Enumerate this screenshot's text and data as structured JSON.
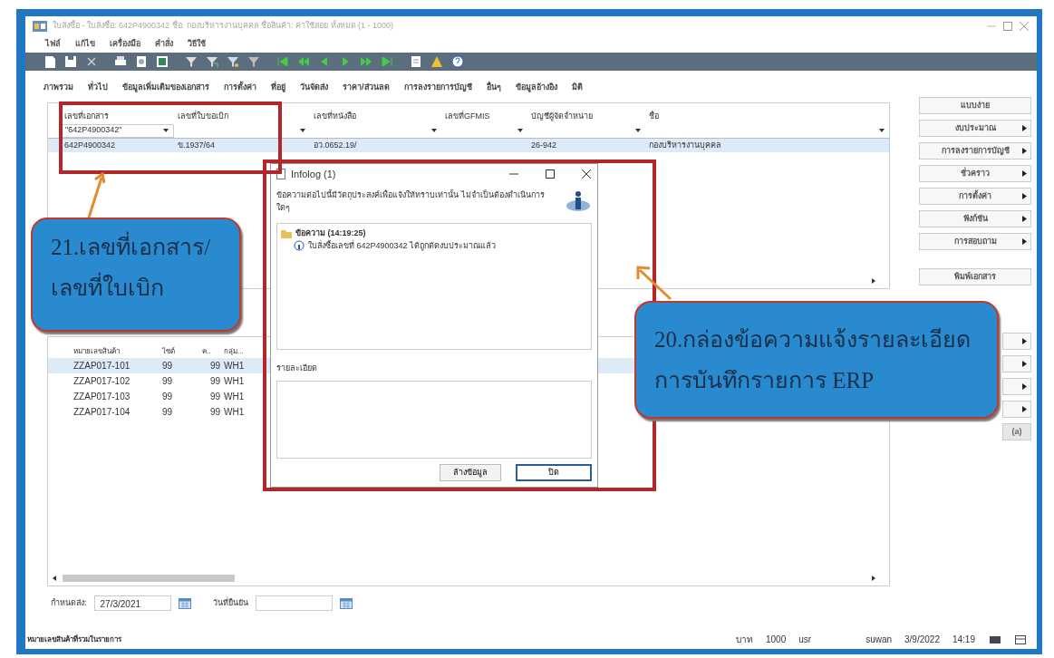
{
  "window": {
    "title": "ใบสั่งซื้อ - ใบสั่งซื้อ: 642P4900342 ชื่อ: กองบริหารงานบุคคล ชื่อสินค้า: ค่าใช้สอย ทั้งหมด (1 - 1000)"
  },
  "menu": [
    "ไฟล์",
    "แก้ไข",
    "เครื่องมือ",
    "คำสั่ง",
    "วิธีใช้"
  ],
  "field_groups": [
    "ภาพรวม",
    "ทั่วไป",
    "ข้อมูลเพิ่มเติมของเอกสาร",
    "การตั้งค่า",
    "ที่อยู่",
    "วันจัดส่ง",
    "ราคา/ส่วนลด",
    "การลงรายการบัญชี",
    "อื่นๆ",
    "ข้อมูลอ้างอิง",
    "มิติ"
  ],
  "header_grid": {
    "columns": [
      "เลขที่เอกสาร",
      "เลขที่ใบขอเบิก",
      "เลขที่หนังสือ",
      "เลขที่GFMIS",
      "บัญชีผู้จัดจำหน่าย",
      "ชื่อ"
    ],
    "filter_value": "\"642P4900342\"",
    "rows": [
      {
        "cells": [
          "642P4900342",
          "ข.1937/64",
          "อว.0652.19/",
          null,
          "26-942",
          "กองบริหารงานบุคคล"
        ],
        "selected": true
      }
    ]
  },
  "side_buttons": [
    {
      "label": "แบบง่าย",
      "kind": "plain"
    },
    {
      "label": "งบประมาณ",
      "kind": "menu"
    },
    {
      "label": "การลงรายการบัญชี",
      "kind": "menu"
    },
    {
      "label": "ชั่วคราว",
      "kind": "menu"
    },
    {
      "label": "การตั้งค่า",
      "kind": "menu"
    },
    {
      "label": "ฟังก์ชัน",
      "kind": "menu"
    },
    {
      "label": "การสอบถาม",
      "kind": "menu"
    }
  ],
  "document_button": {
    "label": "พิมพ์เอกสาร"
  },
  "lines_buttons": [
    {
      "kind": "menu"
    },
    {
      "kind": "menu"
    },
    {
      "kind": "menu"
    },
    {
      "kind": "menu"
    },
    {
      "label": "(a)",
      "kind": "plain",
      "disabled": true
    }
  ],
  "lines_grid": {
    "columns": [
      "หมายเลขสินค้า",
      "ไซต์",
      "ค..",
      "กลุ่ม..."
    ],
    "rows": [
      {
        "cells": [
          "ZZAP017-101",
          "99",
          "99",
          "WH1"
        ],
        "selected": true
      },
      {
        "cells": [
          "ZZAP017-102",
          "99",
          "99",
          "WH1"
        ],
        "selected": false
      },
      {
        "cells": [
          "ZZAP017-103",
          "99",
          "99",
          "WH1"
        ],
        "selected": false
      },
      {
        "cells": [
          "ZZAP017-104",
          "99",
          "99",
          "WH1"
        ],
        "selected": false
      }
    ]
  },
  "dates": [
    {
      "label": "กำหนดส่ง:",
      "value": "27/3/2021"
    },
    {
      "label": "วันที่ยืนยัน"
    }
  ],
  "status_bar": {
    "message": "หมายเลขสินค้าที่รวมในรายการ",
    "fields": [
      "บาท",
      "1000",
      "usr",
      "suwan",
      "3/9/2022",
      "14:19"
    ]
  },
  "dialog": {
    "title": "Infolog (1)",
    "intro": "ข้อความต่อไปนี้มีวัตถุประสงค์เพื่อแจ้งให้ทราบเท่านั้น ไม่จำเป็นต้องดำเนินการใดๆ",
    "tree": [
      {
        "label": "ข้อความ (14:19:25)",
        "children": [
          {
            "label": "ใบสั่งซื้อเลขที่ 642P4900342 ได้ถูกตัดงบประมาณแล้ว"
          }
        ]
      }
    ],
    "details_label": "รายละเอียด",
    "buttons": [
      {
        "label": "ล้างข้อมูล",
        "default": false
      },
      {
        "label": "ปิด",
        "default": true
      }
    ]
  },
  "annotations": [
    {
      "lines": [
        "21.เลขที่เอกสาร/",
        "เลขที่ใบเบิก"
      ]
    },
    {
      "lines": [
        "20.กล่องข้อความแจ้งรายละเอียด",
        "การบันทึกรายการ ERP"
      ]
    }
  ]
}
